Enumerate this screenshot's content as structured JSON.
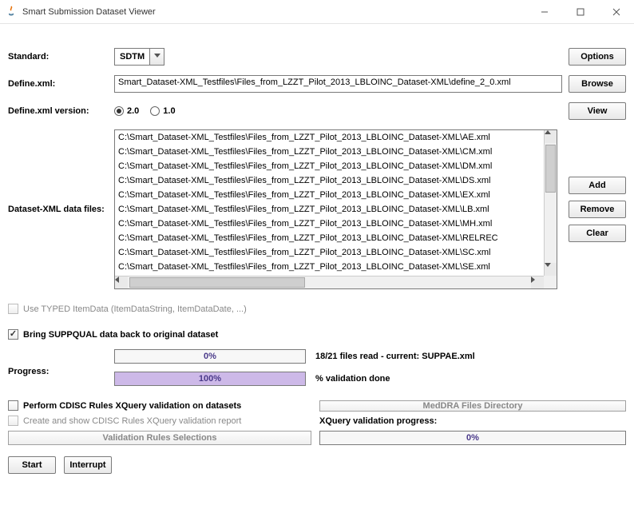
{
  "window": {
    "title": "Smart Submission Dataset Viewer"
  },
  "labels": {
    "standard": "Standard:",
    "definexml": "Define.xml:",
    "definever": "Define.xml version:",
    "datafiles": "Dataset-XML data files:",
    "progress": "Progress:",
    "progressStatus": "18/21 files read - current: SUPPAE.xml",
    "validationDone": "% validation done",
    "xqueryProg": "XQuery validation progress:"
  },
  "standard": {
    "value": "SDTM"
  },
  "definexml": {
    "value": "Smart_Dataset-XML_Testfiles\\Files_from_LZZT_Pilot_2013_LBLOINC_Dataset-XML\\define_2_0.xml"
  },
  "defineVersion": {
    "opt1": "2.0",
    "opt2": "1.0",
    "selected": "2.0"
  },
  "dataFiles": [
    "C:\\Smart_Dataset-XML_Testfiles\\Files_from_LZZT_Pilot_2013_LBLOINC_Dataset-XML\\AE.xml",
    "C:\\Smart_Dataset-XML_Testfiles\\Files_from_LZZT_Pilot_2013_LBLOINC_Dataset-XML\\CM.xml",
    "C:\\Smart_Dataset-XML_Testfiles\\Files_from_LZZT_Pilot_2013_LBLOINC_Dataset-XML\\DM.xml",
    "C:\\Smart_Dataset-XML_Testfiles\\Files_from_LZZT_Pilot_2013_LBLOINC_Dataset-XML\\DS.xml",
    "C:\\Smart_Dataset-XML_Testfiles\\Files_from_LZZT_Pilot_2013_LBLOINC_Dataset-XML\\EX.xml",
    "C:\\Smart_Dataset-XML_Testfiles\\Files_from_LZZT_Pilot_2013_LBLOINC_Dataset-XML\\LB.xml",
    "C:\\Smart_Dataset-XML_Testfiles\\Files_from_LZZT_Pilot_2013_LBLOINC_Dataset-XML\\MH.xml",
    "C:\\Smart_Dataset-XML_Testfiles\\Files_from_LZZT_Pilot_2013_LBLOINC_Dataset-XML\\RELREC",
    "C:\\Smart_Dataset-XML_Testfiles\\Files_from_LZZT_Pilot_2013_LBLOINC_Dataset-XML\\SC.xml",
    "C:\\Smart_Dataset-XML_Testfiles\\Files_from_LZZT_Pilot_2013_LBLOINC_Dataset-XML\\SE.xml"
  ],
  "checkboxes": {
    "typedItemData": "Use TYPED ItemData (ItemDataString, ItemDataDate, ...)",
    "suppqual": "Bring SUPPQUAL data back to original dataset",
    "performCdisc": "Perform CDISC Rules XQuery validation on datasets",
    "createReport": "Create and show CDISC Rules XQuery validation report"
  },
  "progress1": {
    "percent": 0,
    "text": "0%"
  },
  "progress2": {
    "percent": 100,
    "text": "100%"
  },
  "progress3": {
    "percent": 0,
    "text": "0%"
  },
  "buttons": {
    "options": "Options",
    "browse": "Browse",
    "view": "View",
    "add": "Add",
    "remove": "Remove",
    "clear": "Clear",
    "rulesSel": "Validation Rules Selections",
    "meddra": "MedDRA Files Directory",
    "start": "Start",
    "interrupt": "Interrupt"
  }
}
